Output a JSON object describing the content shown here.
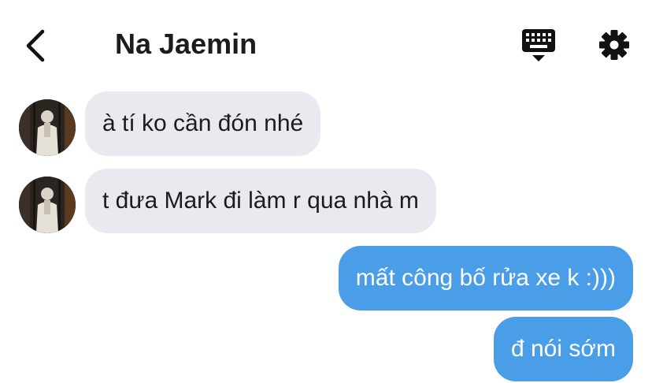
{
  "header": {
    "back_icon": "chevron-left-icon",
    "title": "Na Jaemin",
    "keyboard_icon": "keyboard-icon",
    "settings_icon": "gear-icon"
  },
  "messages": [
    {
      "direction": "incoming",
      "text": "à tí ko cần đón nhé"
    },
    {
      "direction": "incoming",
      "text": "t đưa Mark đi làm r qua nhà m"
    },
    {
      "direction": "outgoing",
      "text": "mất công bố rửa xe k :)))"
    },
    {
      "direction": "outgoing",
      "text": "đ nói sớm"
    }
  ],
  "colors": {
    "incoming_bubble": "#e9eaef",
    "outgoing_bubble": "#4a9ee8",
    "text_dark": "#1c1c1e",
    "text_light": "#ffffff"
  }
}
